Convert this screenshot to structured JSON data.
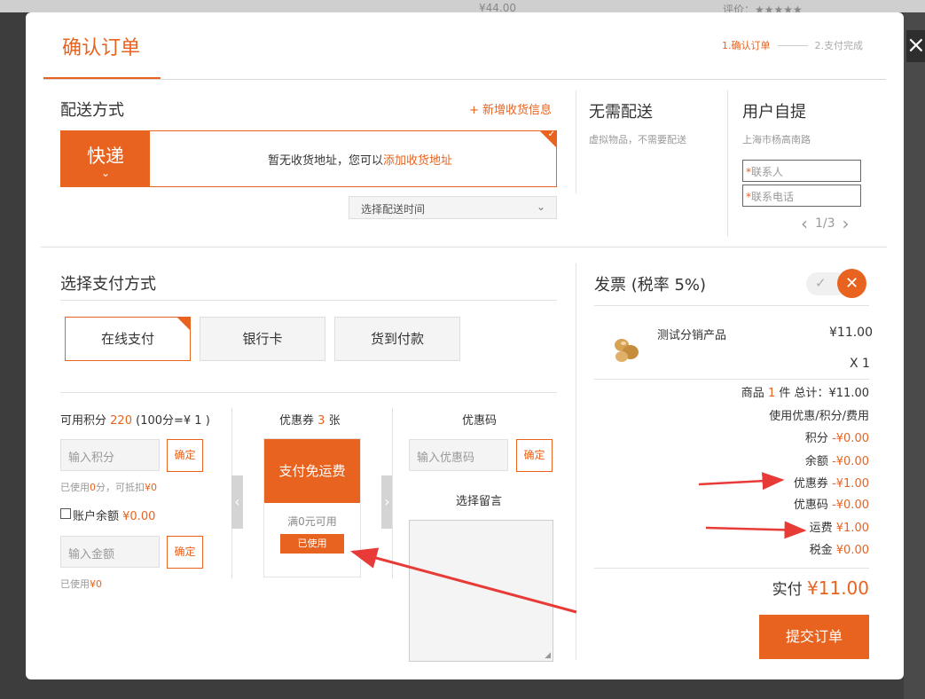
{
  "background": {
    "left_text": "¥44.00",
    "right_text": "评价：★★★★★"
  },
  "modal": {
    "title": "确认订单",
    "steps": {
      "step1": "1.确认订单",
      "step2": "2.支付完成"
    }
  },
  "delivery": {
    "title": "配送方式",
    "add_address": "+ 新增收货信息",
    "express_label": "快递",
    "no_address_prefix": "暂无收货地址，您可以",
    "add_address_link": "添加收货地址",
    "time_select": "选择配送时间"
  },
  "no_delivery": {
    "title": "无需配送",
    "desc": "虚拟物品，不需要配送"
  },
  "self_pickup": {
    "title": "用户自提",
    "address": "上海市杨高南路",
    "contact_placeholder": "联系人",
    "phone_placeholder": "联系电话",
    "page": "1/3"
  },
  "payment": {
    "title": "选择支付方式",
    "methods": [
      "在线支付",
      "银行卡",
      "货到付款"
    ]
  },
  "points": {
    "label_prefix": "可用积分",
    "value": "220",
    "rate": "(100分=¥ 1 )",
    "placeholder": "输入积分",
    "confirm": "确定",
    "used_prefix": "已使用",
    "used_value": "0",
    "used_mid": "分，可抵扣",
    "used_money": "¥0"
  },
  "balance": {
    "label": "账户余额",
    "value": "¥0.00",
    "placeholder": "输入金额",
    "confirm": "确定",
    "used_prefix": "已使用",
    "used_value": "¥0"
  },
  "coupons": {
    "label_prefix": "优惠券",
    "count": "3",
    "label_suffix": "张",
    "card_title": "支付免运费",
    "card_condition": "满0元可用",
    "card_status": "已使用"
  },
  "promo_code": {
    "label": "优惠码",
    "placeholder": "输入优惠码",
    "confirm": "确定"
  },
  "message": {
    "label": "选择留言"
  },
  "invoice": {
    "title": "发票 (税率 5%)"
  },
  "product": {
    "name": "测试分销产品",
    "price": "¥11.00",
    "qty": "X 1"
  },
  "summary": {
    "goods_prefix": "商品",
    "goods_count": "1",
    "goods_suffix": "件 总计：¥11.00",
    "discount_header": "使用优惠/积分/费用",
    "rows": [
      {
        "label": "积分",
        "value": "-¥0.00"
      },
      {
        "label": "余额",
        "value": "-¥0.00"
      },
      {
        "label": "优惠券",
        "value": "-¥1.00"
      },
      {
        "label": "优惠码",
        "value": "-¥0.00"
      },
      {
        "label": "运费",
        "value": "¥1.00"
      },
      {
        "label": "税金",
        "value": "¥0.00"
      }
    ],
    "pay_label": "实付",
    "pay_value": "¥11.00",
    "submit": "提交订单"
  },
  "colors": {
    "accent": "#e8631f",
    "annotation": "#e83a36"
  }
}
